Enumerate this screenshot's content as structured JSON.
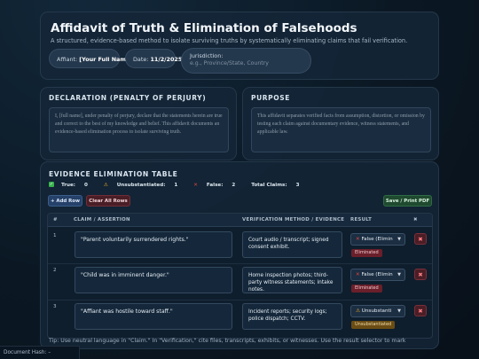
{
  "header": {
    "title": "Affidavit of Truth & Elimination of Falsehoods",
    "subtitle": "A structured, evidence-based method to isolate surviving truths by systematically eliminating claims that fail verification.",
    "affiant_label": "Affiant:",
    "affiant_value": "[Your Full Name]",
    "date_label": "Date:",
    "date_value": "11/2/2025",
    "jurisdiction_label": "Jurisdiction:",
    "jurisdiction_placeholder": "e.g., Province/State, Country"
  },
  "declaration": {
    "title": "DECLARATION (PENALTY OF PERJURY)",
    "text": "I, [full name], under penalty of perjury, declare that the statements herein are true and correct to the best of my knowledge and belief. This affidavit documents an evidence-based elimination process to isolate surviving truth."
  },
  "purpose": {
    "title": "PURPOSE",
    "text": "This affidavit separates verified facts from assumption, distortion, or omission by testing each claim against documentary evidence, witness statements, and applicable law."
  },
  "evidence": {
    "title": "EVIDENCE ELIMINATION TABLE",
    "stats": {
      "true_label": "True:",
      "true_count": "0",
      "unsub_label": "Unsubstantiated:",
      "unsub_count": "1",
      "false_label": "False:",
      "false_count": "2",
      "total_label": "Total Claims:",
      "total_count": "3"
    },
    "add_row_label": "+ Add Row",
    "clear_rows_label": "Clear All Rows",
    "save_label": "Save / Print PDF",
    "columns": {
      "num": "#",
      "claim": "CLAIM / ASSERTION",
      "verification": "VERIFICATION METHOD / EVIDENCE",
      "result": "RESULT",
      "del": "✖"
    },
    "rows": [
      {
        "num": "1",
        "claim": "\"Parent voluntarily surrendered rights.\"",
        "verification": "Court audio / transcript; signed consent exhibit.",
        "result": "False (Elimin",
        "badge": "Eliminated"
      },
      {
        "num": "2",
        "claim": "\"Child was in imminent danger.\"",
        "verification": "Home inspection photos; third-party witness statements; intake notes.",
        "result": "False (Elimin",
        "badge": "Eliminated"
      },
      {
        "num": "3",
        "claim": "\"Affiant was hostile toward staff.\"",
        "verification": "Incident reports; security logs; police dispatch; CCTV.",
        "result": "Unsubstanti",
        "badge": "Unsubstantiated"
      }
    ],
    "tip": "Tip: Use neutral language in \"Claim.\" In \"Verification,\" cite files, transcripts, exhibits, or witnesses. Use the result selector to mark"
  },
  "footer": {
    "hash_label": "Document Hash:",
    "hash_value": "–"
  },
  "colors": {
    "background": "#0b1824",
    "true_green": "#38b24e",
    "warn_amber": "#e0a12a",
    "false_red": "#e0463f",
    "eliminated_badge": "#6a1f2a",
    "unsubstantiated_badge": "#6b4d14"
  }
}
